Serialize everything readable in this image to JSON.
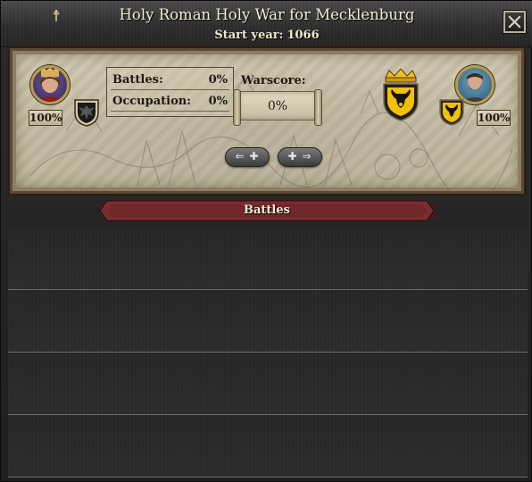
{
  "window": {
    "title": "Holy Roman Holy War for Mecklenburg",
    "start_year_label": "Start year:",
    "start_year_value": "1066",
    "close_icon": "close-x-icon"
  },
  "war_summary": {
    "attacker": {
      "portrait_icon": "crowned-ruler-portrait",
      "strength": "100%",
      "coat_of_arms_icon": "black-eagle-on-gold-icon"
    },
    "defender": {
      "portrait_icon": "bearded-ruler-portrait",
      "strength": "100%",
      "coat_of_arms_icon": "black-bull-head-on-gold-icon"
    },
    "stats": {
      "battles_label": "Battles:",
      "battles_value": "0%",
      "occupation_label": "Occupation:",
      "occupation_value": "0%"
    },
    "warscore_label": "Warscore:",
    "warscore_value": "0%",
    "target_title_icon": "crowned-bull-head-shield-icon",
    "prev_button": "⇐ ✚",
    "next_button": "✚ ⇒"
  },
  "battles": {
    "header": "Battles",
    "rows": [
      "",
      "",
      "",
      ""
    ]
  },
  "colors": {
    "parchment": "#c9c0a8",
    "ribbon": "#7a2e30",
    "gold": "#f2c200",
    "frame": "#5b4a36"
  }
}
